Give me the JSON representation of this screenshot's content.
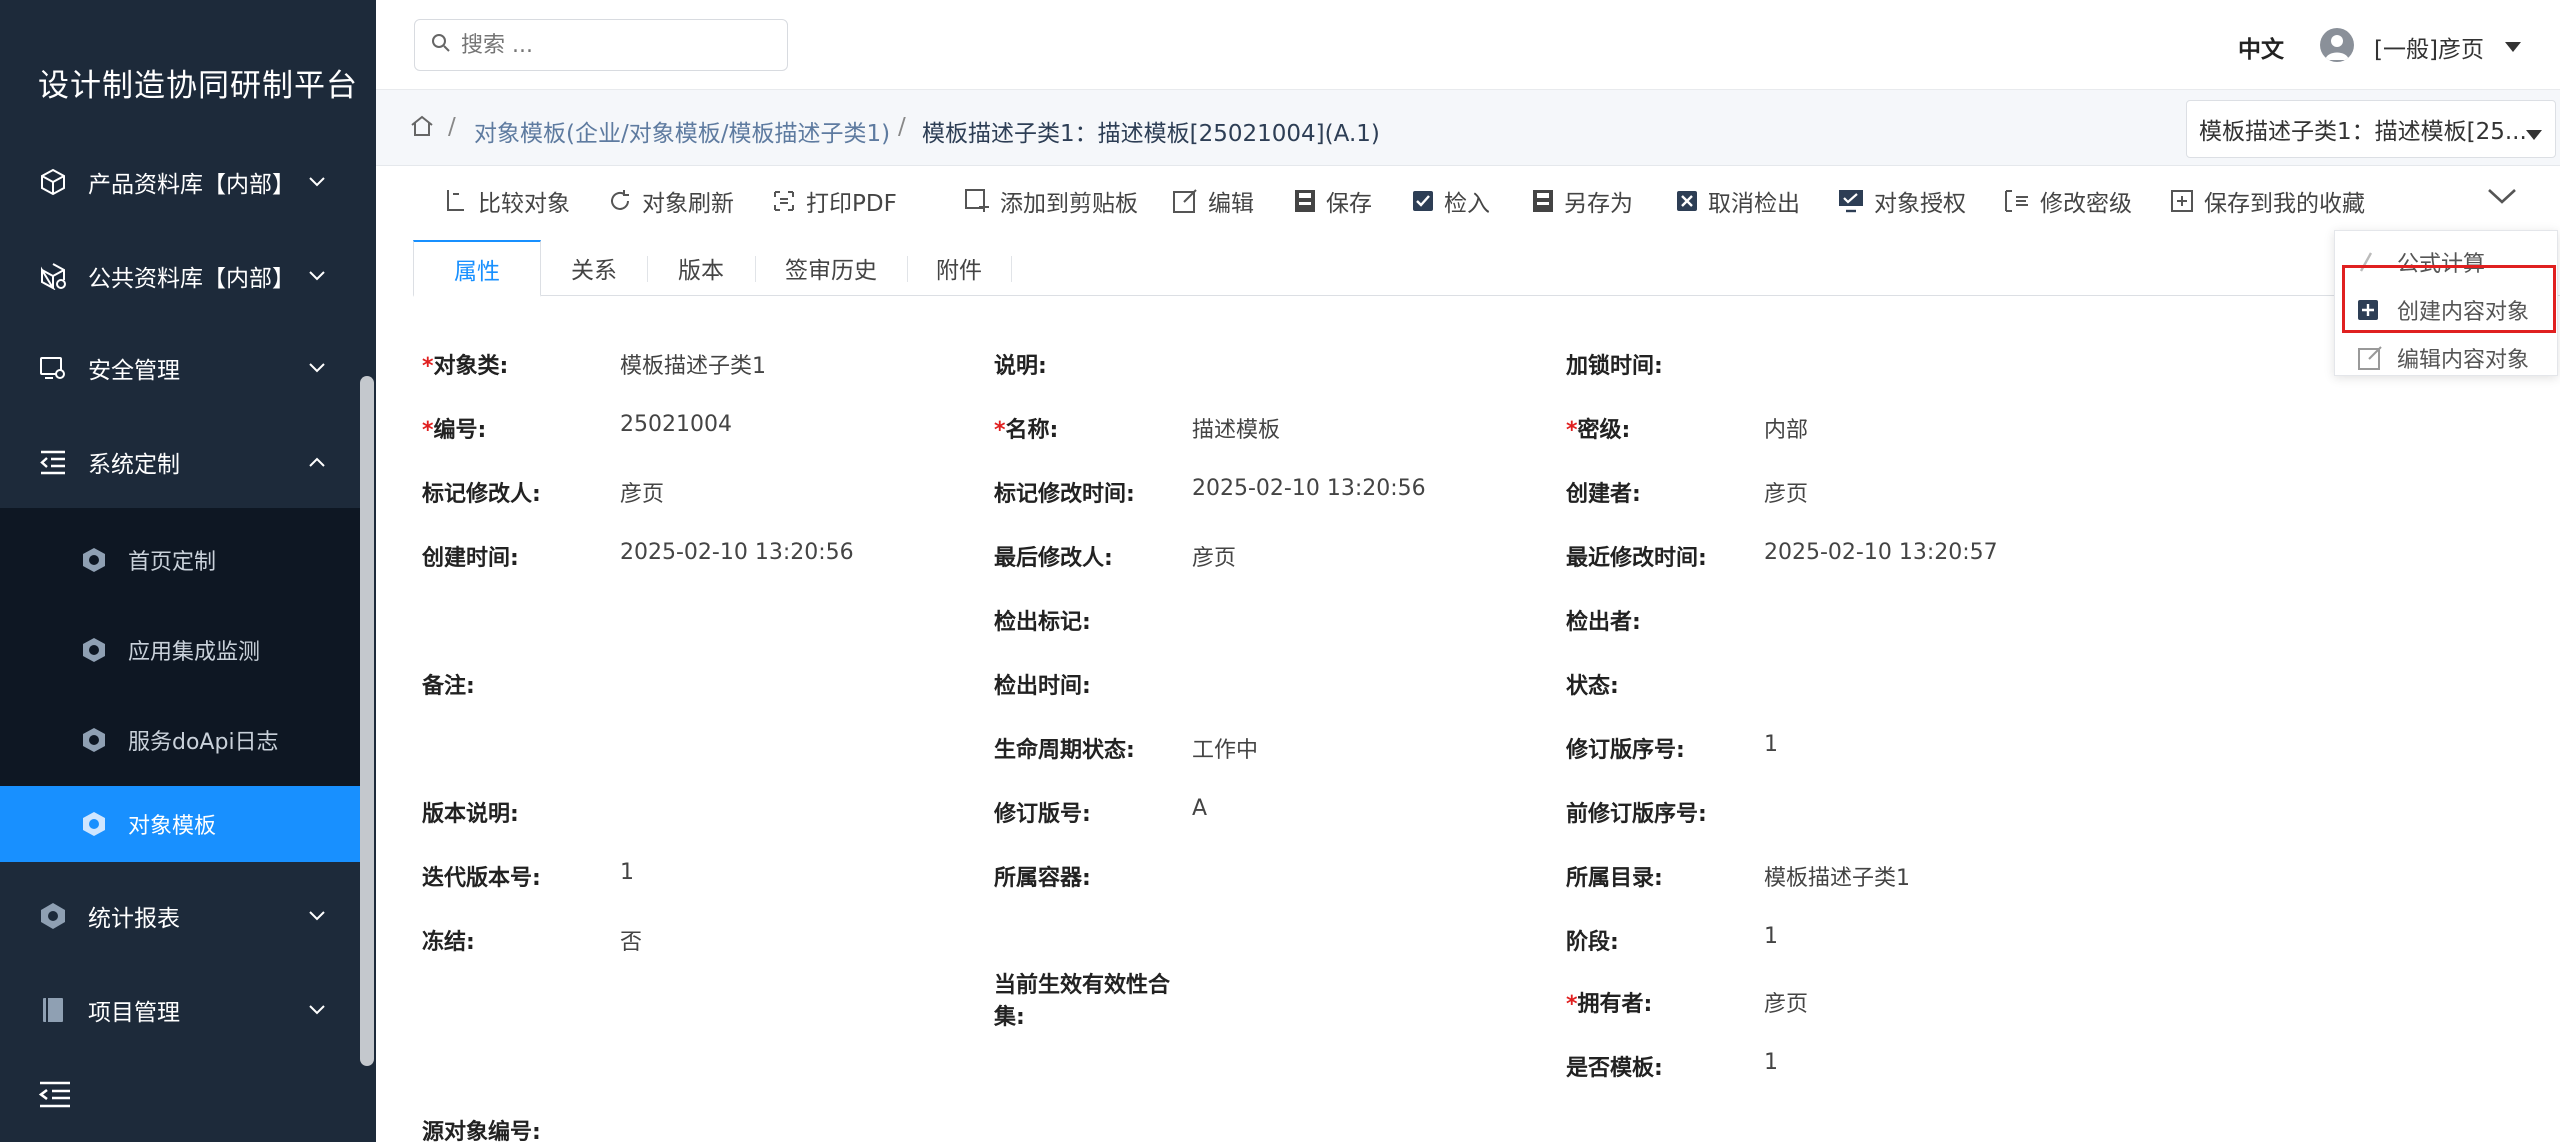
{
  "app": {
    "title": "设计制造协同研制平台"
  },
  "sidebar": {
    "items": [
      {
        "label": "产品资料库【内部】",
        "icon": "cube-icon"
      },
      {
        "label": "公共资料库【内部】",
        "icon": "cube-gear-icon"
      },
      {
        "label": "安全管理",
        "icon": "screen-gear-icon"
      },
      {
        "label": "系统定制",
        "icon": "indent-icon",
        "expanded": true
      },
      {
        "label": "统计报表",
        "icon": "hexagon-icon"
      },
      {
        "label": "项目管理",
        "icon": "book-icon"
      }
    ],
    "sub_items": [
      {
        "label": "首页定制"
      },
      {
        "label": "应用集成监测"
      },
      {
        "label": "服务doApi日志"
      },
      {
        "label": "对象模板",
        "active": true
      }
    ]
  },
  "header": {
    "search_placeholder": "搜索 ...",
    "language": "中文",
    "user": "[一般]彦页"
  },
  "breadcrumb": {
    "parent": "对象模板(企业/对象模板/模板描述子类1)",
    "current": "模板描述子类1：描述模板[25021004](A.1)",
    "object_select": "模板描述子类1：描述模板[25..."
  },
  "toolbar": {
    "buttons": [
      "比较对象",
      "对象刷新",
      "打印PDF",
      "添加到剪贴板",
      "编辑",
      "保存",
      "检入",
      "另存为",
      "取消检出",
      "对象授权",
      "修改密级",
      "保存到我的收藏"
    ]
  },
  "tabs": [
    "属性",
    "关系",
    "版本",
    "签审历史",
    "附件"
  ],
  "dropdown": {
    "items": [
      "公式计算",
      "创建内容对象",
      "编辑内容对象"
    ]
  },
  "form": {
    "col1": [
      {
        "label": "对象类:",
        "value": "模板描述子类1",
        "required": true
      },
      {
        "label": "编号:",
        "value": "25021004",
        "required": true
      },
      {
        "label": "标记修改人:",
        "value": "彦页"
      },
      {
        "label": "创建时间:",
        "value": "2025-02-10 13:20:56"
      },
      {
        "label": "备注:",
        "value": ""
      },
      {
        "label": "版本说明:",
        "value": ""
      },
      {
        "label": "迭代版本号:",
        "value": "1"
      },
      {
        "label": "冻结:",
        "value": "否"
      },
      {
        "label": "源对象编号:",
        "value": ""
      }
    ],
    "col2": [
      {
        "label": "说明:",
        "value": ""
      },
      {
        "label": "名称:",
        "value": "描述模板",
        "required": true
      },
      {
        "label": "标记修改时间:",
        "value": "2025-02-10 13:20:56"
      },
      {
        "label": "最后修改人:",
        "value": "彦页"
      },
      {
        "label": "检出标记:",
        "value": ""
      },
      {
        "label": "检出时间:",
        "value": ""
      },
      {
        "label": "生命周期状态:",
        "value": "工作中"
      },
      {
        "label": "修订版号:",
        "value": "A"
      },
      {
        "label": "所属容器:",
        "value": ""
      },
      {
        "label_line1": "当前生效有效性合",
        "label_line2": "集:",
        "value": ""
      }
    ],
    "col3": [
      {
        "label": "加锁时间:",
        "value": ""
      },
      {
        "label": "密级:",
        "value": "内部",
        "required": true
      },
      {
        "label": "创建者:",
        "value": "彦页"
      },
      {
        "label": "最近修改时间:",
        "value": "2025-02-10 13:20:57"
      },
      {
        "label": "检出者:",
        "value": ""
      },
      {
        "label": "状态:",
        "value": ""
      },
      {
        "label": "修订版序号:",
        "value": "1"
      },
      {
        "label": "前修订版序号:",
        "value": ""
      },
      {
        "label": "所属目录:",
        "value": "模板描述子类1"
      },
      {
        "label": "阶段:",
        "value": "1"
      },
      {
        "label": "拥有者:",
        "value": "彦页",
        "required": true
      },
      {
        "label": "是否模板:",
        "value": "1"
      }
    ]
  }
}
